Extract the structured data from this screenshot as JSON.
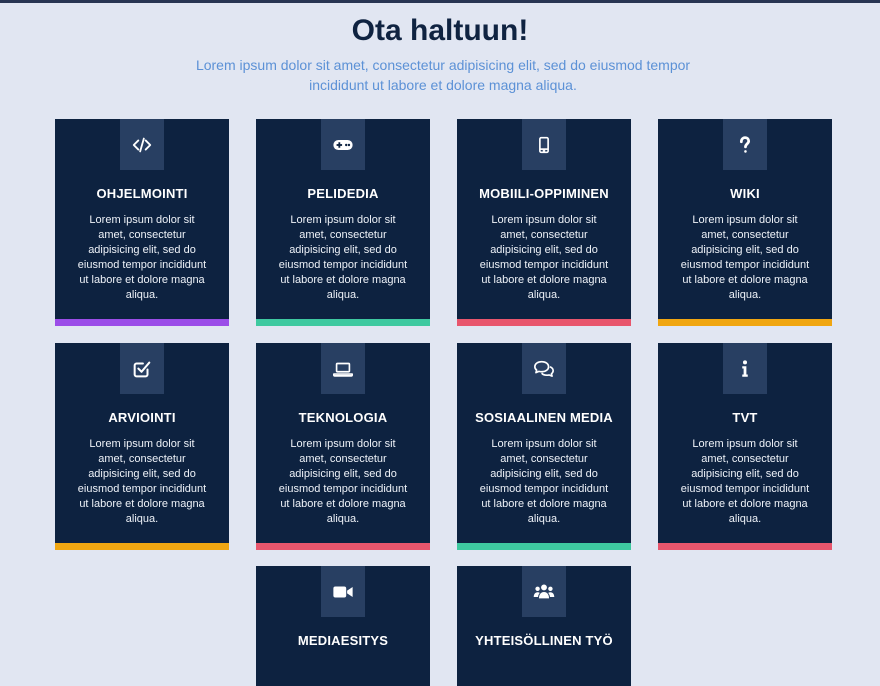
{
  "header": {
    "title": "Ota haltuun!",
    "subtitle": "Lorem ipsum dolor sit amet, consectetur adipisicing elit, sed do eiusmod tempor incididunt ut labore et dolore magna aliqua."
  },
  "colors": {
    "background": "#e1e6f2",
    "card": "#0d2240",
    "icon_box": "#283f62",
    "title": "#0f2341",
    "subtitle": "#5c91d6"
  },
  "cards": [
    {
      "title": "OHJELMOINTI",
      "icon": "code-icon",
      "accent": "#9b4de8",
      "text": "Lorem ipsum dolor sit amet, consectetur adipisicing elit, sed do eiusmod tempor incididunt ut labore et dolore magna aliqua."
    },
    {
      "title": "PELIDEDIA",
      "icon": "gamepad-icon",
      "accent": "#3ec9a0",
      "text": "Lorem ipsum dolor sit amet, consectetur adipisicing elit, sed do eiusmod tempor incididunt ut labore et dolore magna aliqua."
    },
    {
      "title": "MOBIILI-OPPIMINEN",
      "icon": "mobile-phone-icon",
      "accent": "#e8566d",
      "text": "Lorem ipsum dolor sit amet, consectetur adipisicing elit, sed do eiusmod tempor incididunt ut labore et dolore magna aliqua."
    },
    {
      "title": "WIKI",
      "icon": "question-mark-icon",
      "accent": "#f0a612",
      "text": "Lorem ipsum dolor sit amet, consectetur adipisicing elit, sed do eiusmod tempor incididunt ut labore et dolore magna aliqua."
    },
    {
      "title": "ARVIOINTI",
      "icon": "checkbox-icon",
      "accent": "#f0a612",
      "text": "Lorem ipsum dolor sit amet, consectetur adipisicing elit, sed do eiusmod tempor incididunt ut labore et dolore magna aliqua."
    },
    {
      "title": "TEKNOLOGIA",
      "icon": "laptop-icon",
      "accent": "#e8566d",
      "text": "Lorem ipsum dolor sit amet, consectetur adipisicing elit, sed do eiusmod tempor incididunt ut labore et dolore magna aliqua."
    },
    {
      "title": "SOSIAALINEN MEDIA",
      "icon": "chat-bubbles-icon",
      "accent": "#3ec9a0",
      "text": "Lorem ipsum dolor sit amet, consectetur adipisicing elit, sed do eiusmod tempor incididunt ut labore et dolore magna aliqua."
    },
    {
      "title": "TVT",
      "icon": "info-icon",
      "accent": "#e8566d",
      "text": "Lorem ipsum dolor sit amet, consectetur adipisicing elit, sed do eiusmod tempor incididunt ut labore et dolore magna aliqua."
    },
    {
      "title": "MEDIAESITYS",
      "icon": "video-camera-icon",
      "accent": "",
      "text": ""
    },
    {
      "title": "YHTEISÖLLINEN TYÖ",
      "icon": "users-group-icon",
      "accent": "",
      "text": ""
    }
  ]
}
